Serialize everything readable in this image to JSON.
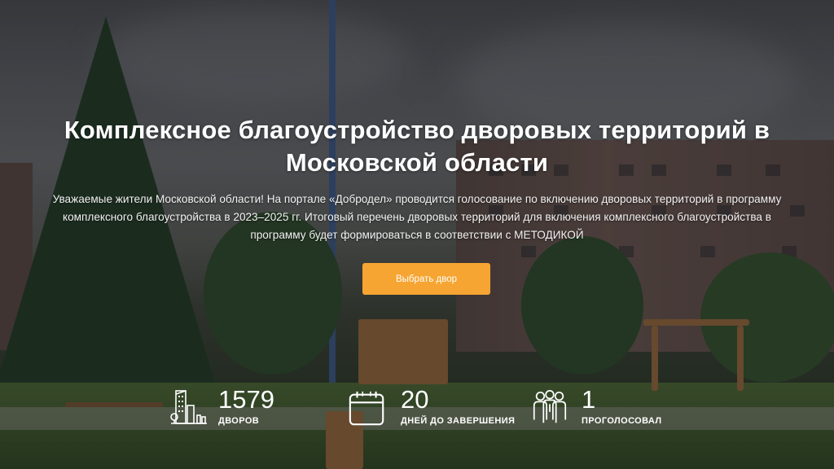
{
  "hero": {
    "title": "Комплексное благоустройство дворовых территорий в Московской области",
    "description": "Уважаемые жители Московской области! На портале «Добродел» проводится голосование по включению дворовых территорий в программу комплексного благоустройства в 2023–2025 гг. Итоговый перечень дворовых территорий для включения комплексного благоустройства в программу будет формироваться в соответствии с МЕТОДИКОЙ",
    "cta_label": "Выбрать двор"
  },
  "stats": [
    {
      "icon": "buildings-icon",
      "value": "1579",
      "label": "ДВОРОВ"
    },
    {
      "icon": "calendar-icon",
      "value": "20",
      "label": "ДНЕЙ ДО ЗАВЕРШЕНИЯ"
    },
    {
      "icon": "people-group-icon",
      "value": "1",
      "label": "ПРОГОЛОСОВАЛ"
    }
  ],
  "colors": {
    "accent": "#f6a533",
    "text": "#ffffff"
  }
}
